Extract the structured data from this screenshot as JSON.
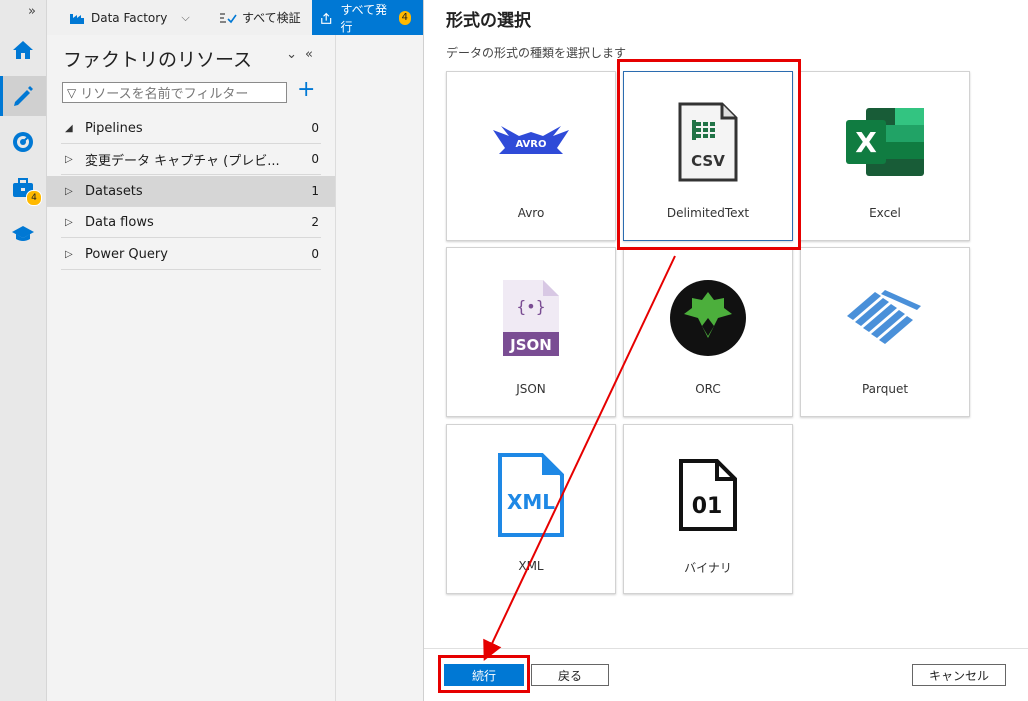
{
  "toolbar": {
    "factory_label": "Data Factory",
    "validate_label": "すべて検証",
    "publish_label": "すべて発行",
    "publish_count": "4"
  },
  "rail": {
    "collapse_glyph": "»",
    "manage_badge": "4",
    "items": [
      "home-icon",
      "author-pencil-icon",
      "monitor-gauge-icon",
      "manage-toolbox-icon",
      "learn-cap-icon"
    ],
    "accent": "#0078d4"
  },
  "panel": {
    "title": "ファクトリのリソース",
    "filter_placeholder": "リソースを名前でフィルター",
    "resources": [
      {
        "label": "Pipelines",
        "count": "0",
        "expanded": true
      },
      {
        "label": "変更データ キャプチャ (プレビ...",
        "count": "0",
        "expanded": false
      },
      {
        "label": "Datasets",
        "count": "1",
        "expanded": false,
        "selected": true
      },
      {
        "label": "Data flows",
        "count": "2",
        "expanded": false
      },
      {
        "label": "Power Query",
        "count": "0",
        "expanded": false
      }
    ]
  },
  "dialog": {
    "title": "形式の選択",
    "subtitle": "データの形式の種類を選択します",
    "formats": [
      {
        "label": "Avro",
        "icon": "avro-logo-icon"
      },
      {
        "label": "DelimitedText",
        "icon": "csv-file-icon",
        "selected": true,
        "icon_text": "CSV"
      },
      {
        "label": "Excel",
        "icon": "excel-icon",
        "icon_text": "X"
      },
      {
        "label": "JSON",
        "icon": "json-file-icon",
        "icon_text": "JSON",
        "icon_sub": "{•}"
      },
      {
        "label": "ORC",
        "icon": "orc-logo-icon"
      },
      {
        "label": "Parquet",
        "icon": "parquet-logo-icon"
      },
      {
        "label": "XML",
        "icon": "xml-file-icon",
        "icon_text": "XML"
      },
      {
        "label": "バイナリ",
        "icon": "binary-file-icon",
        "icon_text": "01"
      }
    ],
    "avro_text": "AVRO",
    "continue_label": "続行",
    "back_label": "戻る",
    "cancel_label": "キャンセル",
    "highlight_color": "#e60000"
  }
}
